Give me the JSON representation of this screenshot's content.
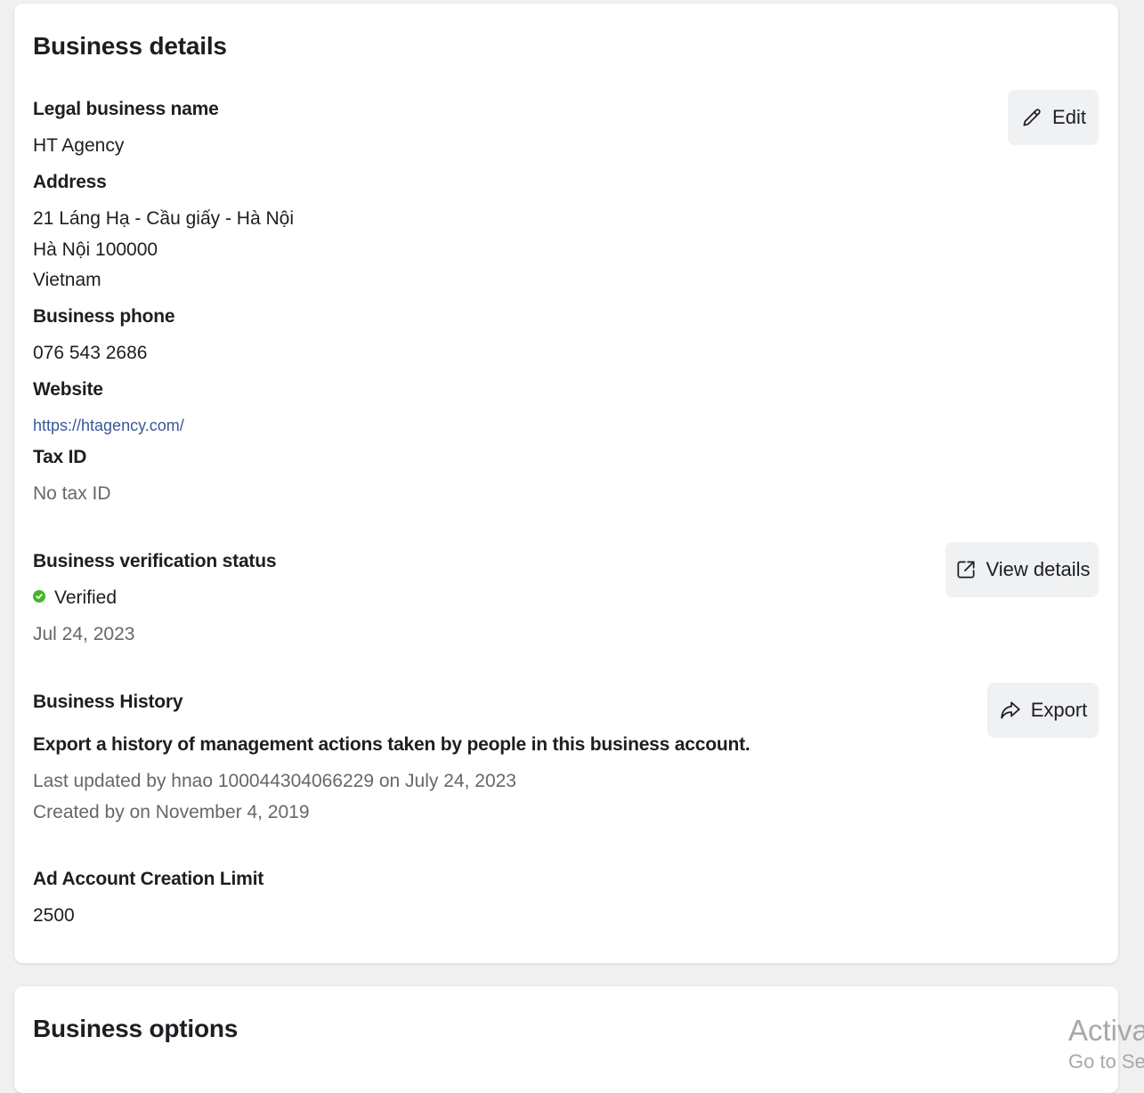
{
  "details": {
    "title": "Business details",
    "legal_name_label": "Legal business name",
    "legal_name": "HT Agency",
    "address_label": "Address",
    "address_lines": [
      "21 Láng Hạ - Cầu giấy - Hà Nội",
      "Hà Nội 100000",
      "Vietnam"
    ],
    "phone_label": "Business phone",
    "phone": "076 543 2686",
    "website_label": "Website",
    "website": "https://htagency.com/",
    "tax_label": "Tax ID",
    "tax_value": "No tax ID",
    "edit_button": "Edit",
    "verification_label": "Business verification status",
    "verification_status": "Verified",
    "verification_date": "Jul 24, 2023",
    "view_details_button": "View details",
    "history_label": "Business History",
    "history_description": "Export a history of management actions taken by people in this business account.",
    "history_updated": "Last updated by hnao 100044304066229 on July 24, 2023",
    "history_created": "Created by on November 4, 2019",
    "export_button": "Export",
    "ad_limit_label": "Ad Account Creation Limit",
    "ad_limit_value": "2500"
  },
  "options": {
    "title": "Business options"
  },
  "watermark": {
    "line1": "Activate",
    "line2": "Go to Sett"
  },
  "icons": {
    "edit": "pencil-icon",
    "view_details": "external-link-icon",
    "export": "share-arrow-icon",
    "verified": "check-circle-icon"
  },
  "colors": {
    "verified": "#42b72a",
    "link": "#385898",
    "muted": "#65676b",
    "button_bg": "#f0f1f2"
  }
}
